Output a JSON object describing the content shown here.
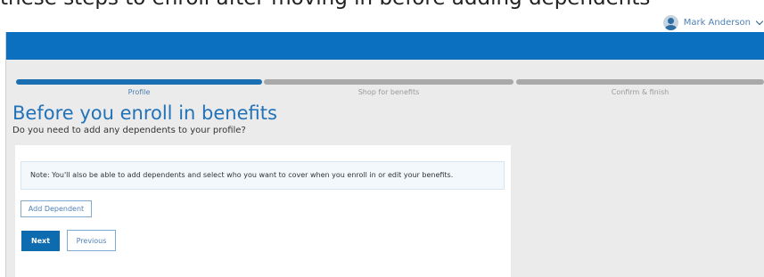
{
  "partial_top_text": "these steps to enroll after moving in before adding dependents",
  "user_menu": {
    "name": "Mark Anderson",
    "avatar_icon": "user-avatar-icon",
    "chevron_icon": "chevron-down-icon"
  },
  "progress": {
    "steps": [
      {
        "label": "Profile",
        "state": "active"
      },
      {
        "label": "Shop for benefits",
        "state": "inactive"
      },
      {
        "label": "Confirm & finish",
        "state": "inactive"
      }
    ],
    "active_color": "#1a6fb3",
    "inactive_color": "#a9a9a9"
  },
  "page": {
    "title": "Before you enroll in benefits",
    "subtitle": "Do you need to add any dependents to your profile?"
  },
  "note": {
    "text": "Note: You'll also be able to add dependents and select who you want to cover when you enroll in or edit your benefits."
  },
  "buttons": {
    "add_dependent": "Add Dependent",
    "next": "Next",
    "previous": "Previous"
  },
  "colors": {
    "header_blue": "#0b70bf",
    "link_blue": "#4f81b3",
    "title_blue": "#2272b8",
    "background_grey": "#ebebeb"
  }
}
